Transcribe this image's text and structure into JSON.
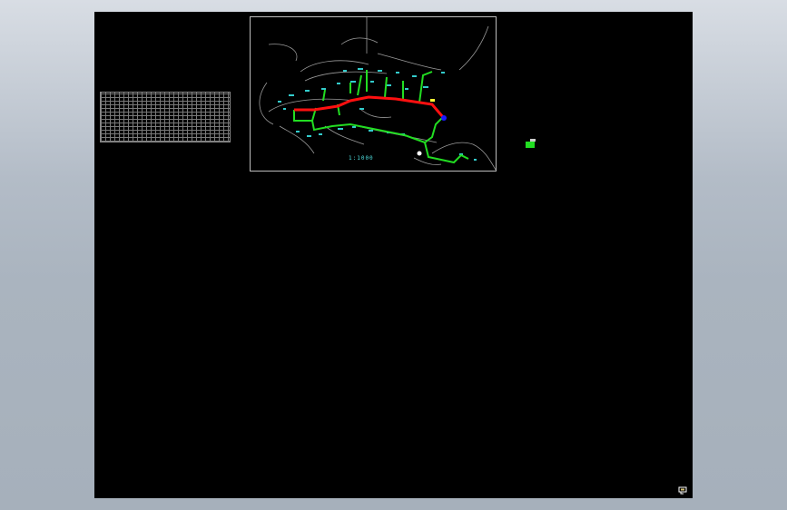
{
  "viewport": {
    "background_top": "#d8dde4",
    "background_bottom": "#a6b0bb",
    "model_space_color": "#000000"
  },
  "drawing": {
    "map_frame": {
      "scale_label": "1:1000",
      "colors": {
        "main_line": "#ff1010",
        "branch_line": "#22dd22",
        "annotation": "#33cccc",
        "road_outline": "#9a9a9a",
        "marker": "#1a1aff",
        "highlight": "#ffff33"
      }
    },
    "grid_table": {
      "line_color": "#7a7a7a"
    },
    "legend_swatch": {
      "color": "#22dd22"
    },
    "ucs_icon": {
      "icon": "ucs-icon",
      "color": "#ffffff"
    }
  }
}
